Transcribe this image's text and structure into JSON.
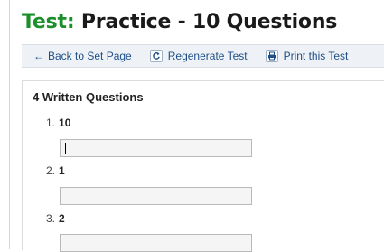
{
  "header": {
    "title_prefix": "Test:",
    "title_rest": " Practice - 10 Questions"
  },
  "toolbar": {
    "back_label": "Back to Set Page",
    "regenerate_label": "Regenerate Test",
    "print_label": "Print this Test"
  },
  "section": {
    "title": "4 Written Questions",
    "questions": [
      {
        "number": "1.",
        "term": "10",
        "answer": "",
        "focused": true
      },
      {
        "number": "2.",
        "term": "1",
        "answer": "",
        "focused": false
      },
      {
        "number": "3.",
        "term": "2",
        "answer": "",
        "focused": false
      }
    ]
  },
  "colors": {
    "accent_green": "#1a8f2a",
    "link_blue": "#1f4f88",
    "toolbar_bg": "#eef2f6"
  }
}
